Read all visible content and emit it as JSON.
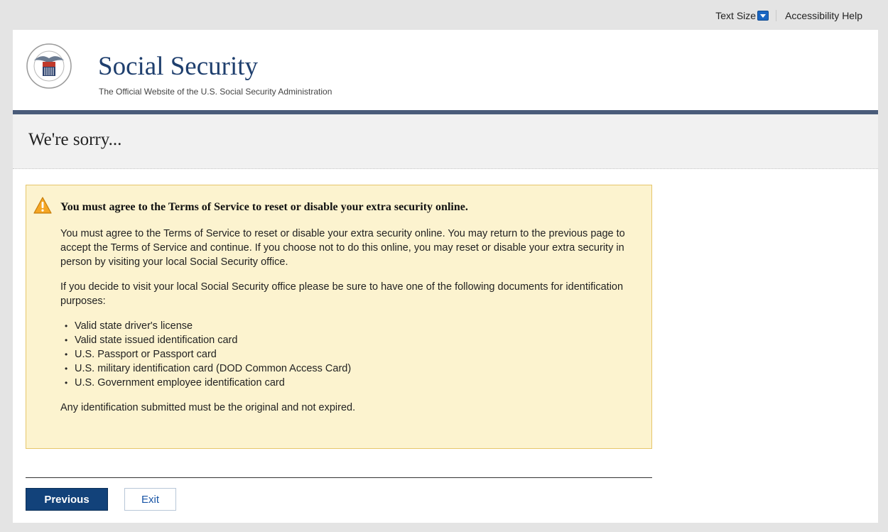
{
  "top_bar": {
    "text_size_label": "Text Size",
    "accessibility_help_label": "Accessibility Help"
  },
  "header": {
    "title": "Social Security",
    "tagline": "The Official Website of the U.S. Social Security Administration",
    "seal_icon": "ssa-seal-icon",
    "accent_color": "#4a5c7a"
  },
  "page_title": "We're sorry...",
  "alert": {
    "icon": "warning-icon",
    "heading": "You must agree to the Terms of Service to reset or disable your extra security online.",
    "paragraph1": "You must agree to the Terms of Service to reset or disable your extra security online. You may return to the previous page to accept the Terms of Service and continue. If you choose not to do this online, you may reset or disable your extra security in person by visiting your local Social Security office.",
    "paragraph2": "If you decide to visit your local Social Security office please be sure to have one of the following documents for identification purposes:",
    "documents": [
      "Valid state driver's license",
      "Valid state issued identification card",
      "U.S. Passport or Passport card",
      "U.S. military identification card (DOD Common Access Card)",
      "U.S. Government employee identification card"
    ],
    "paragraph3": "Any identification submitted must be the original and not expired.",
    "background_color": "#fcf3cf",
    "border_color": "#e6c66b"
  },
  "buttons": {
    "previous_label": "Previous",
    "exit_label": "Exit",
    "primary_color": "#12427a"
  }
}
